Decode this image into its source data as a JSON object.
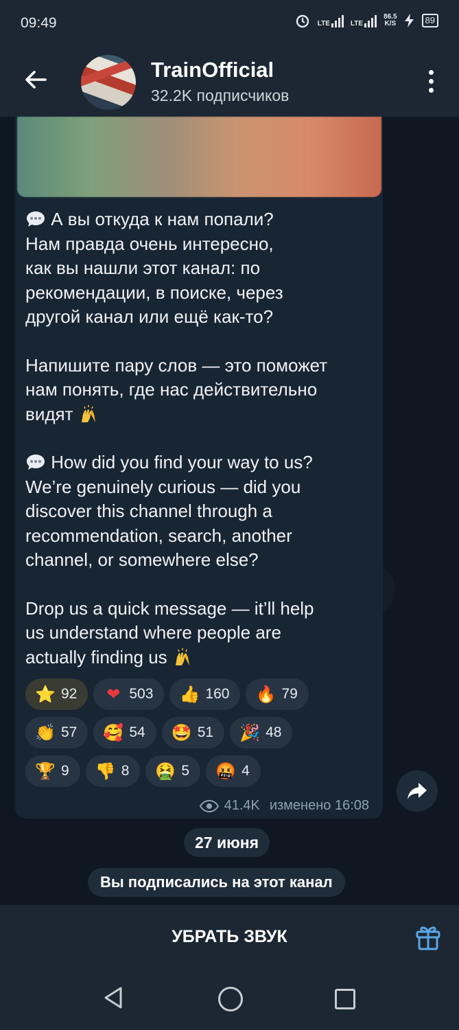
{
  "status_bar": {
    "time": "09:49",
    "net_speed_value": "86.5",
    "net_speed_unit": "K/S",
    "signal_label_1": "LTE",
    "signal_label_2": "LTE",
    "battery": "89"
  },
  "header": {
    "title": "TrainOfficial",
    "subtitle": "32.2K подписчиков"
  },
  "post": {
    "paragraphs": [
      "А вы откуда к нам попали?\nНам правда очень интересно,\nкак вы нашли этот канал: по\nрекомендации, в поиске, через\nдругой канал или ещё как-то?",
      "Напишите пару слов — это поможет\nнам понять, где нас действительно\nвидят",
      "How did you find your way to us?\nWe’re genuinely curious — did you\ndiscover this channel through a\nrecommendation, search, another\nchannel, or somewhere else?",
      "Drop us a quick message — it’ll help\nus understand where people are\nactually finding us"
    ],
    "reactions": [
      {
        "icon": "star-icon",
        "count": "92"
      },
      {
        "icon": "heart-icon",
        "count": "503"
      },
      {
        "icon": "thumbs-up-icon",
        "count": "160"
      },
      {
        "icon": "fire-icon",
        "count": "79"
      },
      {
        "icon": "clapping-hands-icon",
        "count": "57"
      },
      {
        "icon": "smiling-face-with-hearts-icon",
        "count": "54"
      },
      {
        "icon": "star-struck-icon",
        "count": "51"
      },
      {
        "icon": "party-popper-icon",
        "count": "48"
      },
      {
        "icon": "trophy-icon",
        "count": "9"
      },
      {
        "icon": "thumbs-down-icon",
        "count": "8"
      },
      {
        "icon": "nauseated-face-icon",
        "count": "5"
      },
      {
        "icon": "cursing-face-icon",
        "count": "4"
      }
    ],
    "views": "41.4K",
    "edited_time": "изменено 16:08"
  },
  "date_chip": "27 июня",
  "service_message": "Вы подписались на этот канал",
  "bottom_bar": {
    "mute_label": "УБРАТЬ ЗВУК"
  },
  "colors": {
    "background": "#0e1621",
    "bar": "#1c2733",
    "bubble": "#182533",
    "pill": "#263444",
    "accent": "#5aa7e6"
  }
}
